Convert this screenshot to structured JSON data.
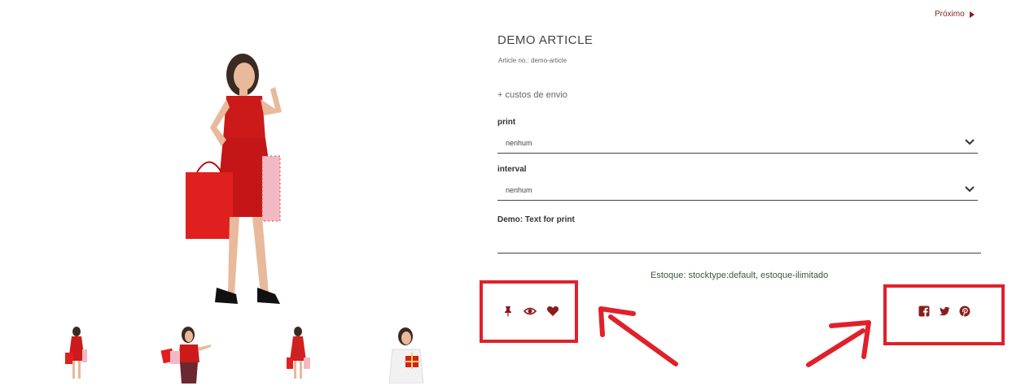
{
  "nav": {
    "next_label": "Próximo"
  },
  "product": {
    "title": "DEMO ARTICLE",
    "article_no": "Article no.: demo-article",
    "shipping_note": "+ custos de envio"
  },
  "options": {
    "print": {
      "label": "print",
      "selected": "nenhum"
    },
    "interval": {
      "label": "interval",
      "selected": "nenhum"
    },
    "text_for_print": {
      "label": "Demo: Text for print",
      "value": ""
    }
  },
  "stock_text": "Estoque: stocktype:default, estoque-ilimitado",
  "action_icons": [
    "pin-icon",
    "eye-icon",
    "heart-icon"
  ],
  "social_icons": [
    "facebook-icon",
    "twitter-icon",
    "pinterest-icon"
  ],
  "colors": {
    "accent": "#8a1c1c",
    "annotation": "#e0202a",
    "stock_text": "#3a5a3a"
  }
}
